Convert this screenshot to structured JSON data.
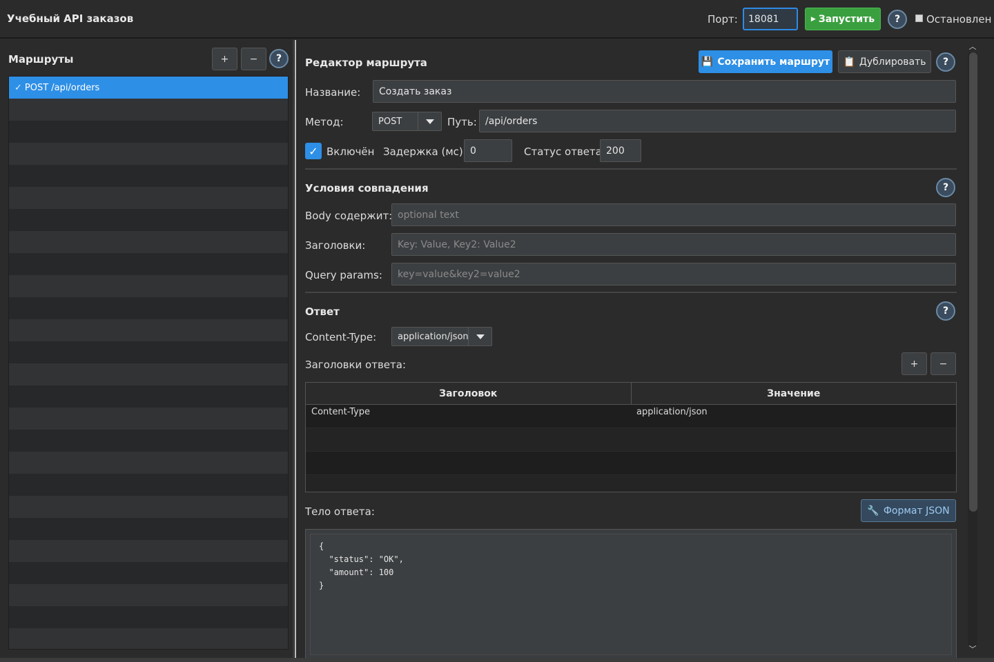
{
  "app": {
    "title": "Учебный API заказов"
  },
  "toolbar": {
    "port_label": "Порт:",
    "port_value": "18081",
    "run_label": "Запустить",
    "help": "?",
    "status_label": "Остановлен"
  },
  "routes": {
    "title": "Маршруты",
    "add": "+",
    "remove": "−",
    "help": "?",
    "items": [
      {
        "label": "POST /api/orders",
        "selected": true
      }
    ]
  },
  "editor": {
    "title": "Редактор маршрута",
    "save_label": "Сохранить маршрут",
    "duplicate_label": "Дублировать",
    "help": "?",
    "name_label": "Название:",
    "name_value": "Создать заказ",
    "method_label": "Метод:",
    "method_value": "POST",
    "path_label": "Путь:",
    "path_value": "/api/orders",
    "enabled_label": "Включён",
    "delay_label": "Задержка (мс):",
    "delay_value": "0",
    "status_label": "Статус ответа:",
    "status_value": "200"
  },
  "match": {
    "title": "Условия совпадения",
    "help": "?",
    "body_label": "Body содержит:",
    "body_placeholder": "optional text",
    "headers_label": "Заголовки:",
    "headers_placeholder": "Key: Value, Key2: Value2",
    "query_label": "Query params:",
    "query_placeholder": "key=value&key2=value2"
  },
  "response": {
    "title": "Ответ",
    "help": "?",
    "content_type_label": "Content-Type:",
    "content_type_value": "application/json",
    "headers_label": "Заголовки ответа:",
    "add": "+",
    "remove": "−",
    "table": {
      "columns": [
        "Заголовок",
        "Значение"
      ],
      "rows": [
        [
          "Content-Type",
          "application/json"
        ]
      ]
    },
    "body_label": "Тело ответа:",
    "format_label": "Формат JSON",
    "body_text": "{\n  \"status\": \"OK\",\n  \"amount\": 100\n}"
  },
  "colors": {
    "accent": "#2e8fe6",
    "run": "#3aa03f",
    "background": "#2b2b2b"
  }
}
